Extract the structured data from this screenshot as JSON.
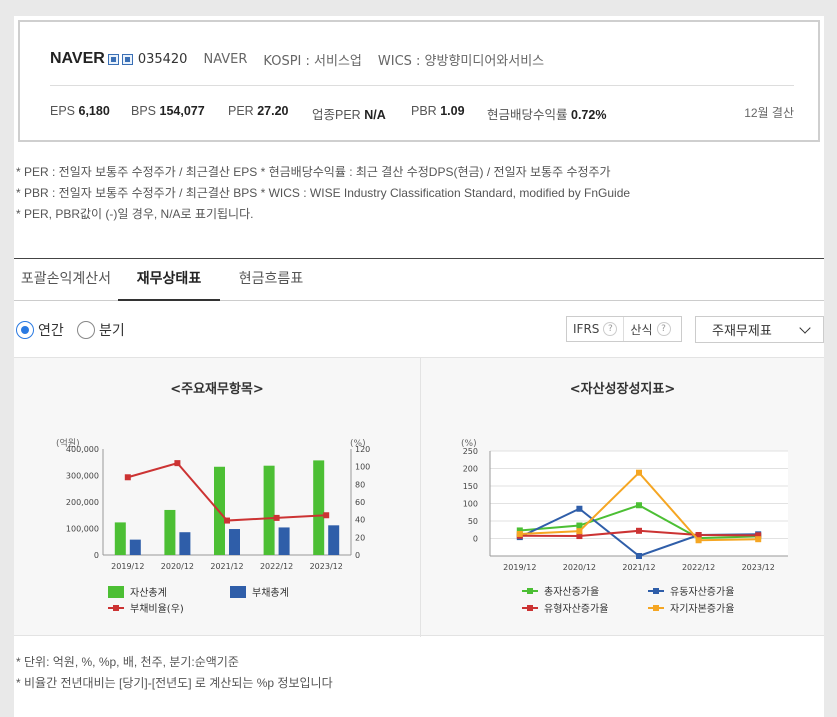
{
  "header": {
    "name": "NAVER",
    "code": "035420",
    "company": "NAVER",
    "market": "KOSPI : 서비스업",
    "wics": "WICS : 양방향미디어와서비스",
    "metrics": [
      {
        "label": "EPS",
        "value": "6,180"
      },
      {
        "label": "BPS",
        "value": "154,077"
      },
      {
        "label": "PER",
        "value": "27.20"
      },
      {
        "label": "업종PER",
        "value": "N/A"
      },
      {
        "label": "PBR",
        "value": "1.09"
      },
      {
        "label": "현금배당수익률",
        "value": "0.72%"
      }
    ],
    "fiscal": "12월 결산"
  },
  "notes": [
    "* PER : 전일자 보통주 수정주가 / 최근결산 EPS * 현금배당수익률 : 최근 결산 수정DPS(현금) / 전일자 보통주 수정주가",
    "* PBR : 전일자 보통주 수정주가 / 최근결산 BPS * WICS : WISE Industry Classification Standard, modified by FnGuide",
    "* PER, PBR값이 (-)일 경우, N/A로 표기됩니다."
  ],
  "tabs": [
    "포괄손익계산서",
    "재무상태표",
    "현금흐름표"
  ],
  "controls": {
    "radio_annual": "연간",
    "radio_quarter": "분기",
    "ifrs": "IFRS",
    "formula": "산식",
    "help": "?",
    "select_value": "주재무제표"
  },
  "footer": [
    "* 단위: 억원, %, %p, 배, 천주, 분기:순액기준",
    "* 비율간 전년대비는 [당기]-[전년도] 로 계산되는 %p 정보입니다"
  ],
  "colors": {
    "green": "#4cbf34",
    "blue": "#2f5ea9",
    "red": "#cc3333",
    "orange": "#f5a623",
    "radio_accent": "#2a7ae2"
  },
  "chart_data": [
    {
      "type": "bar",
      "title": "<주요재무항목>",
      "ylabel_left": "(억원)",
      "ylabel_right": "(%)",
      "categories": [
        "2019/12",
        "2020/12",
        "2021/12",
        "2022/12",
        "2023/12"
      ],
      "ylim_left": [
        0,
        400000
      ],
      "yticks_left": [
        "0",
        "100,000",
        "200,000",
        "300,000",
        "400,000"
      ],
      "ylim_right": [
        0,
        120
      ],
      "yticks_right": [
        "0",
        "20",
        "40",
        "60",
        "80",
        "100",
        "120"
      ],
      "series": [
        {
          "name": "자산총계",
          "type": "bar",
          "axis": "left",
          "color": "#4cbf34",
          "values": [
            123000,
            170000,
            333000,
            337000,
            357000
          ]
        },
        {
          "name": "부채총계",
          "type": "bar",
          "axis": "left",
          "color": "#2f5ea9",
          "values": [
            58000,
            86000,
            98000,
            104000,
            112000
          ]
        },
        {
          "name": "부채비율(우)",
          "type": "line",
          "axis": "right",
          "color": "#cc3333",
          "values": [
            88,
            104,
            39,
            42,
            45
          ]
        }
      ],
      "legend": "bottom",
      "grid": false
    },
    {
      "type": "line",
      "title": "<자산성장성지표>",
      "ylabel": "(%)",
      "categories": [
        "2019/12",
        "2020/12",
        "2021/12",
        "2022/12",
        "2023/12"
      ],
      "ylim": [
        -50,
        250
      ],
      "yticks": [
        "0",
        "50",
        "100",
        "150",
        "200",
        "250"
      ],
      "series": [
        {
          "name": "총자산증가율",
          "color": "#4cbf34",
          "values": [
            23,
            37,
            95,
            1,
            6
          ]
        },
        {
          "name": "유동자산증가율",
          "color": "#2f5ea9",
          "values": [
            4,
            85,
            -50,
            10,
            12
          ]
        },
        {
          "name": "유형자산증가율",
          "color": "#cc3333",
          "values": [
            8,
            7,
            22,
            10,
            9
          ]
        },
        {
          "name": "자기자본증가율",
          "color": "#f5a623",
          "values": [
            13,
            21,
            188,
            -5,
            -2
          ]
        }
      ],
      "legend": "bottom",
      "grid": true
    }
  ]
}
